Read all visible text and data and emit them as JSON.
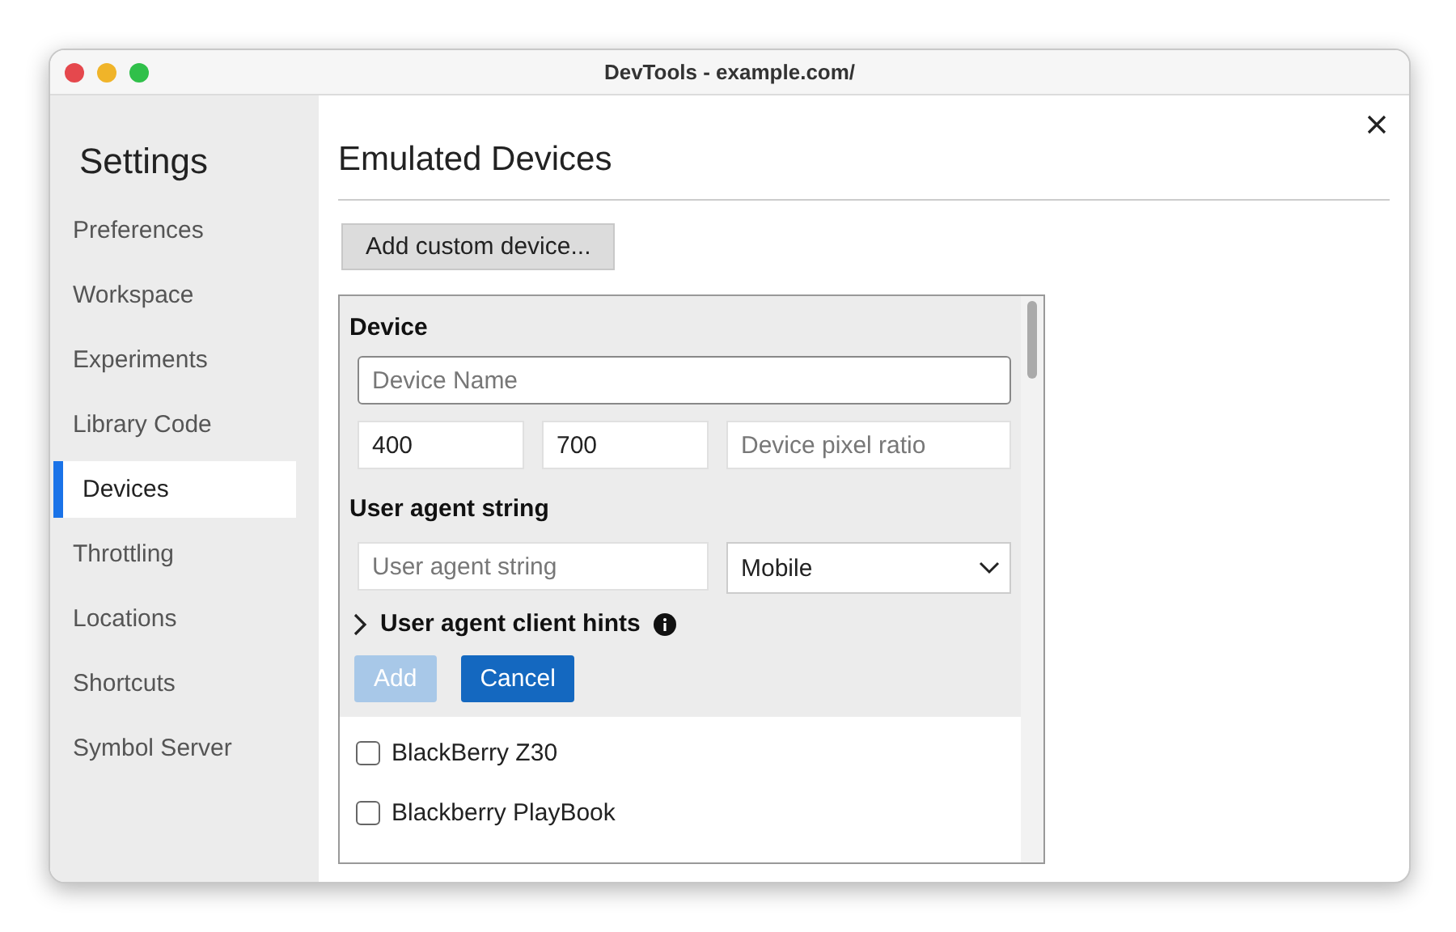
{
  "window": {
    "title": "DevTools - example.com/"
  },
  "sidebar": {
    "title": "Settings",
    "items": [
      {
        "label": "Preferences",
        "selected": false
      },
      {
        "label": "Workspace",
        "selected": false
      },
      {
        "label": "Experiments",
        "selected": false
      },
      {
        "label": "Library Code",
        "selected": false
      },
      {
        "label": "Devices",
        "selected": true
      },
      {
        "label": "Throttling",
        "selected": false
      },
      {
        "label": "Locations",
        "selected": false
      },
      {
        "label": "Shortcuts",
        "selected": false
      },
      {
        "label": "Symbol Server",
        "selected": false
      }
    ]
  },
  "content": {
    "title": "Emulated Devices",
    "add_button": "Add custom device...",
    "form": {
      "device_heading": "Device",
      "name_field": {
        "placeholder": "Device Name"
      },
      "width_field": {
        "value": "400"
      },
      "height_field": {
        "value": "700"
      },
      "dpr_field": {
        "placeholder": "Device pixel ratio"
      },
      "ua_heading": "User agent string",
      "ua_field": {
        "placeholder": "User agent string"
      },
      "ua_type": "Mobile",
      "client_hints": {
        "label": "User agent client hints",
        "expanded": false
      },
      "add": {
        "label": "Add",
        "disabled": true
      },
      "cancel": {
        "label": "Cancel",
        "disabled": false
      }
    },
    "devices": [
      {
        "label": "BlackBerry Z30",
        "checked": false
      },
      {
        "label": "Blackberry PlayBook",
        "checked": false
      }
    ]
  }
}
